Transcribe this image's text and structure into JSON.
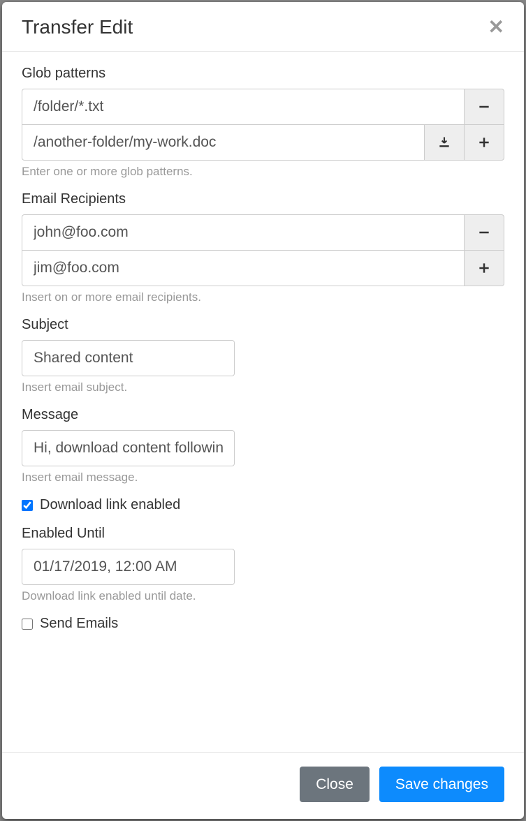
{
  "modal": {
    "title": "Transfer Edit"
  },
  "glob": {
    "label": "Glob patterns",
    "rows": [
      "/folder/*.txt",
      "/another-folder/my-work.doc"
    ],
    "help": "Enter one or more glob patterns."
  },
  "recipients": {
    "label": "Email Recipients",
    "rows": [
      "john@foo.com",
      "jim@foo.com"
    ],
    "help": "Insert on or more email recipients."
  },
  "subject": {
    "label": "Subject",
    "value": "Shared content",
    "help": "Insert email subject."
  },
  "message": {
    "label": "Message",
    "value": "Hi, download content following the link below.",
    "help": "Insert email message."
  },
  "download_enabled": {
    "label": "Download link enabled",
    "checked": true
  },
  "enabled_until": {
    "label": "Enabled Until",
    "value": "01/17/2019, 12:00 AM",
    "help": "Download link enabled until date."
  },
  "send_emails": {
    "label": "Send Emails",
    "checked": false
  },
  "footer": {
    "close": "Close",
    "save": "Save changes"
  }
}
